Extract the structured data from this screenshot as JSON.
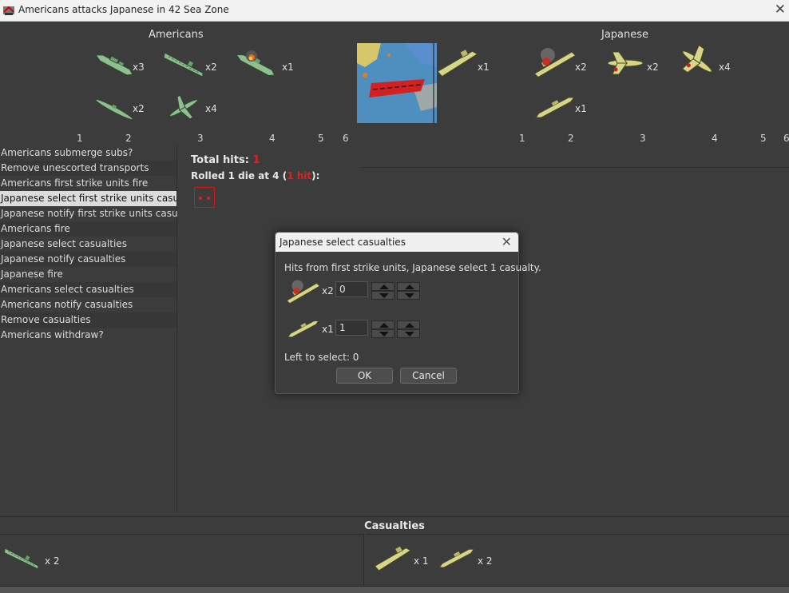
{
  "window": {
    "title": "Americans attacks Japanese in 42 Sea Zone",
    "close_glyph": "✕"
  },
  "colors": {
    "us_unit": "#8fbf8f",
    "jp_unit": "#d6d68a",
    "hit_red": "#e02020"
  },
  "battle": {
    "attacker_title": "Americans",
    "defender_title": "Japanese",
    "attacker_units": [
      {
        "icon": "us-battleship-icon",
        "count": "x3"
      },
      {
        "icon": "us-carrier-icon",
        "count": "x2"
      },
      {
        "icon": "us-damaged-battleship-icon",
        "count": "x1"
      },
      {
        "icon": "us-submarine-icon",
        "count": "x2"
      },
      {
        "icon": "us-fighter-icon",
        "count": "x4"
      }
    ],
    "defender_units": [
      {
        "icon": "jp-transport-icon",
        "count": "x1"
      },
      {
        "icon": "jp-damaged-carrier-icon",
        "count": "x2"
      },
      {
        "icon": "jp-fighter-icon",
        "count": "x2"
      },
      {
        "icon": "jp-bomber-icon",
        "count": "x4"
      },
      {
        "icon": "jp-destroyer-icon",
        "count": "x1"
      }
    ],
    "attacker_ticks": [
      "1",
      "2",
      "3",
      "4",
      "5",
      "6"
    ],
    "defender_ticks": [
      "1",
      "2",
      "3",
      "4",
      "5",
      "6"
    ]
  },
  "steps": [
    "Americans submerge subs?",
    "Remove unescorted transports",
    "Americans first strike units fire",
    "Japanese select first strike units casualties",
    "Japanese notify first strike units casualties",
    "Americans fire",
    "Japanese select casualties",
    "Japanese notify casualties",
    "Japanese fire",
    "Americans select casualties",
    "Americans notify casualties",
    "Remove casualties",
    "Americans withdraw?"
  ],
  "selected_step_index": 3,
  "results": {
    "total_hits_label": "Total hits:",
    "total_hits_value": "1",
    "rolled_prefix": "Rolled 1 die at 4 (",
    "rolled_hit": "1 hit",
    "rolled_suffix": "):",
    "die_value": 2
  },
  "dialog": {
    "title": "Japanese select casualties",
    "message": "Hits from first strike units,  Japanese select 1 casualty.",
    "rows": [
      {
        "icon": "jp-damaged-carrier-icon",
        "count": "x2",
        "value": "0"
      },
      {
        "icon": "jp-destroyer-icon",
        "count": "x1",
        "value": "1"
      }
    ],
    "left_to_select": "Left to select: 0",
    "ok_label": "OK",
    "cancel_label": "Cancel"
  },
  "casualties": {
    "title": "Casualties",
    "attacker": [
      {
        "icon": "us-carrier-icon",
        "count": "x 2"
      }
    ],
    "defender": [
      {
        "icon": "jp-transport-icon",
        "count": "x 1"
      },
      {
        "icon": "jp-destroyer-icon",
        "count": "x 2"
      }
    ]
  }
}
